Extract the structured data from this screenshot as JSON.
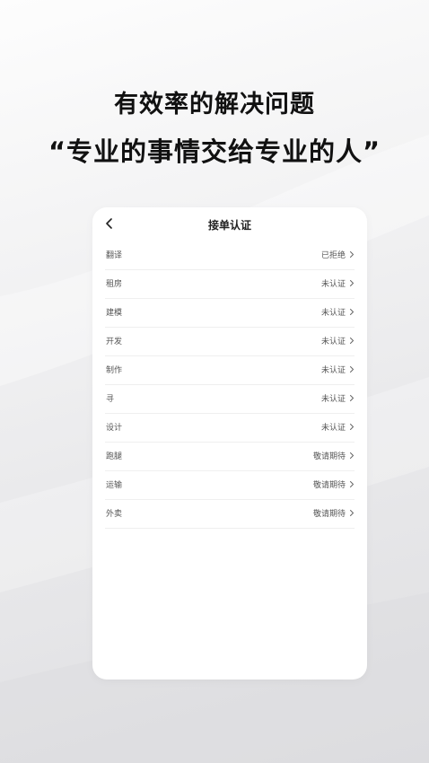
{
  "promo": {
    "headline_line1": "有效率的解决问题",
    "headline_line2": "“专业的事情交给专业的人”"
  },
  "screen": {
    "title": "接单认证",
    "back_icon": "chevron-left-icon",
    "items": [
      {
        "label": "翻译",
        "status": "已拒绝"
      },
      {
        "label": "租房",
        "status": "未认证"
      },
      {
        "label": "建模",
        "status": "未认证"
      },
      {
        "label": "开发",
        "status": "未认证"
      },
      {
        "label": "制作",
        "status": "未认证"
      },
      {
        "label": "寻",
        "status": "未认证"
      },
      {
        "label": "设计",
        "status": "未认证"
      },
      {
        "label": "跑腿",
        "status": "敬请期待"
      },
      {
        "label": "运输",
        "status": "敬请期待"
      },
      {
        "label": "外卖",
        "status": "敬请期待"
      }
    ]
  },
  "colors": {
    "text_primary": "#111111",
    "text_secondary": "#555555",
    "card_background": "#ffffff",
    "divider": "#efefef"
  }
}
